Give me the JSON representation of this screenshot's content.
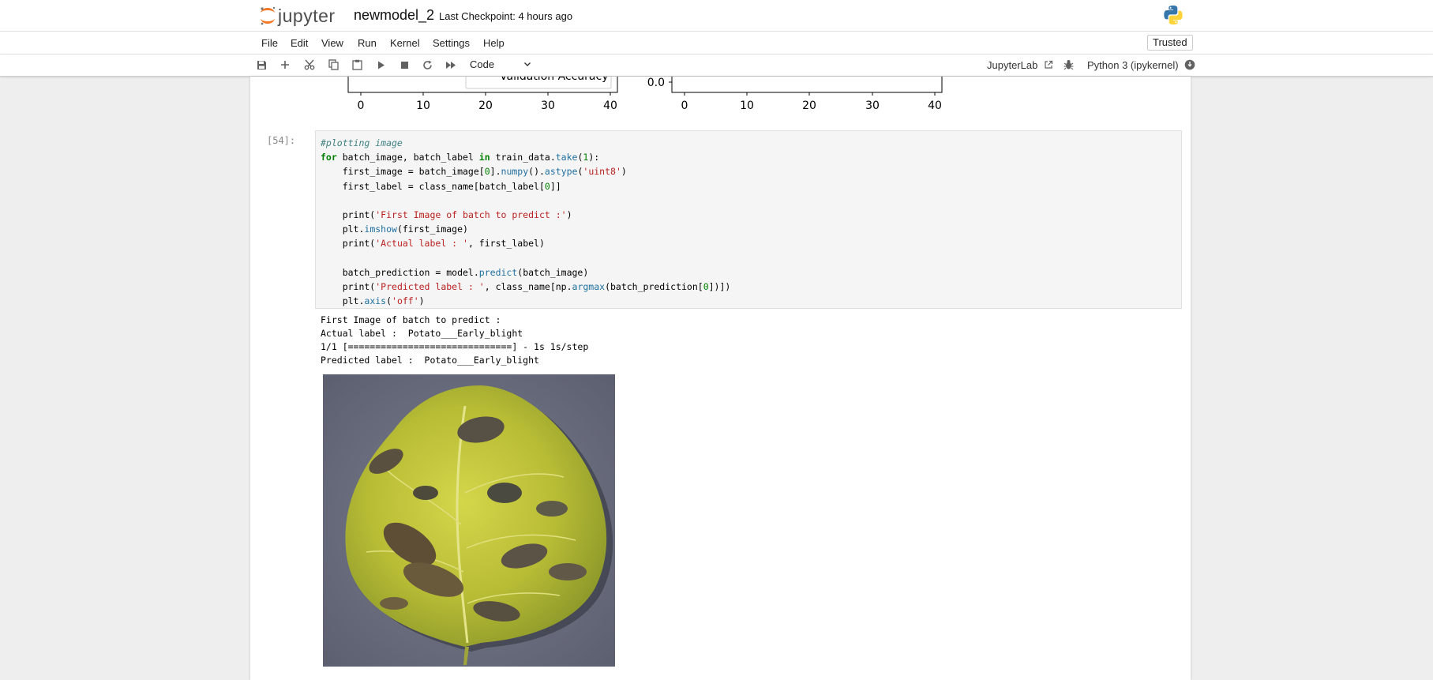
{
  "header": {
    "logo_text": "jupyter",
    "notebook_title": "newmodel_2",
    "checkpoint": "Last Checkpoint: 4 hours ago"
  },
  "menu": {
    "items": [
      "File",
      "Edit",
      "View",
      "Run",
      "Kernel",
      "Settings",
      "Help"
    ],
    "trusted": "Trusted"
  },
  "toolbar": {
    "cell_type": "Code",
    "jupyterlab_label": "JupyterLab",
    "kernel_name": "Python 3 (ipykernel)"
  },
  "prev_output": {
    "legend_label": "Validation Accuracy",
    "left_ticks": [
      "0",
      "10",
      "20",
      "30",
      "40"
    ],
    "right_ticks": [
      "0",
      "10",
      "20",
      "30",
      "40"
    ],
    "right_ytick": "0.0"
  },
  "cell": {
    "prompt": "[54]:",
    "code_lines": [
      "#plotting image",
      "for batch_image, batch_label in train_data.take(1):",
      "    first_image = batch_image[0].numpy().astype('uint8')",
      "    first_label = class_name[batch_label[0]]",
      "",
      "    print('First Image of batch to predict :')",
      "    plt.imshow(first_image)",
      "    print('Actual label : ', first_label)",
      "",
      "    batch_prediction = model.predict(batch_image)",
      "    print('Predicted label : ', class_name[np.argmax(batch_prediction[0])])",
      "    plt.axis('off')"
    ],
    "output_lines": [
      "First Image of batch to predict :",
      "Actual label :  Potato___Early_blight",
      "1/1 [==============================] - 1s 1s/step",
      "Predicted label :  Potato___Early_blight"
    ]
  },
  "icons": {
    "toolbar": [
      "save-icon",
      "add-cell-icon",
      "cut-icon",
      "copy-icon",
      "paste-icon",
      "run-icon",
      "stop-icon",
      "restart-icon",
      "fast-forward-icon"
    ],
    "right": [
      "external-link-icon",
      "debug-bug-icon",
      "kernel-status-icon"
    ]
  },
  "colors": {
    "jupyter_orange": "#f37726",
    "background": "#eeeeee",
    "code_bg": "#f5f5f5",
    "comment": "#408080",
    "keyword": "#008000",
    "string": "#ba2121"
  }
}
